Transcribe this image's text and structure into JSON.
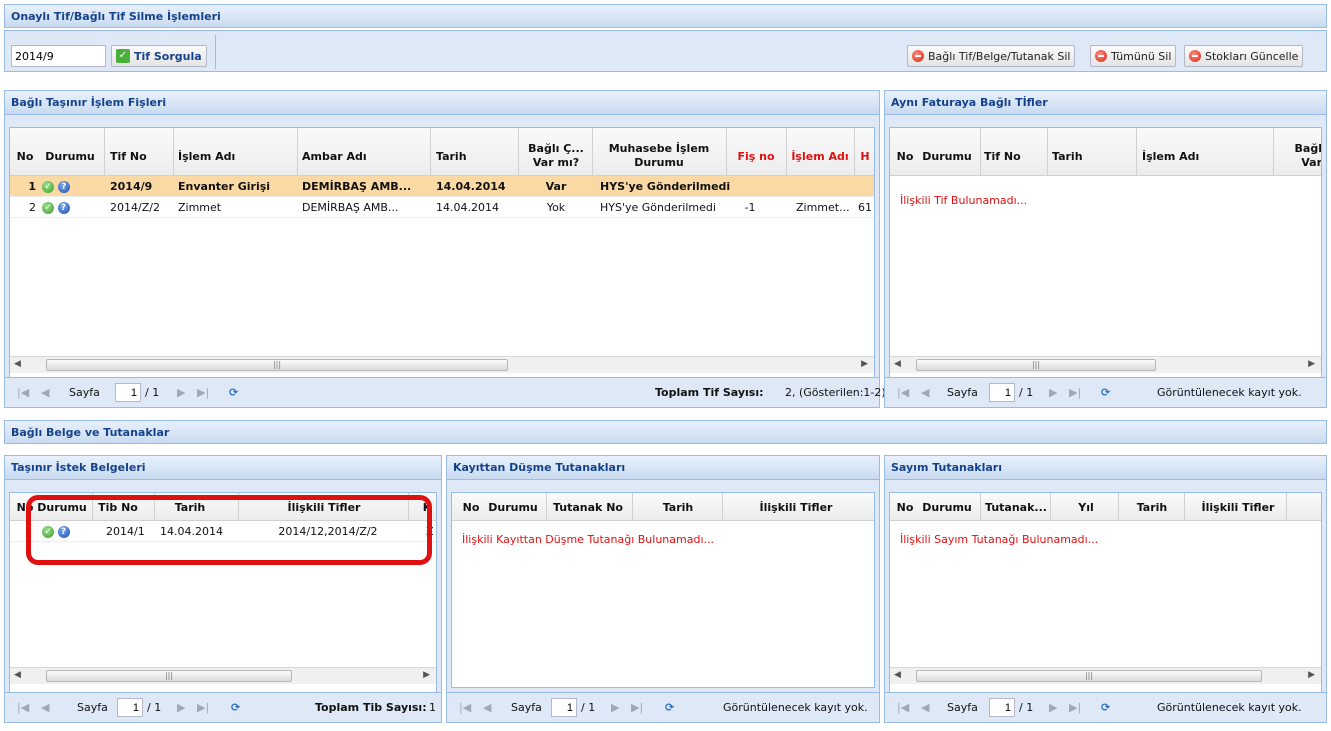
{
  "title": "Onaylı Tif/Bağlı Tif Silme İşlemleri",
  "toolbar": {
    "input_value": "2014/9",
    "query_btn": "Tif Sorgula",
    "delete_linked": "Bağlı Tif/Belge/Tutanak Sil",
    "delete_all": "Tümünü Sil",
    "update_stock": "Stokları Güncelle"
  },
  "bagli": {
    "title": "Bağlı Taşınır İşlem Fişleri",
    "cols": {
      "no": "No",
      "durumu": "Durumu",
      "tifno": "Tif No",
      "islemadi": "İşlem Adı",
      "ambar": "Ambar Adı",
      "tarih": "Tarih",
      "bagli1": "Bağlı Ç...",
      "bagli2": "Var mı?",
      "muh1": "Muhasebe İşlem",
      "muh2": "Durumu",
      "fisno": "Fiş no",
      "islemadi2": "İşlem Adı",
      "h": "H"
    },
    "rows": [
      {
        "no": "1",
        "tifno": "2014/9",
        "islemadi": "Envanter Girişi",
        "ambar": "DEMİRBAŞ AMB...",
        "tarih": "14.04.2014",
        "bagli": "Var",
        "muh": "HYS'ye Gönderilmedi",
        "fisno": "",
        "islemadi2": "",
        "h": ""
      },
      {
        "no": "2",
        "tifno": "2014/Z/2",
        "islemadi": "Zimmet",
        "ambar": "DEMİRBAŞ AMB...",
        "tarih": "14.04.2014",
        "bagli": "Yok",
        "muh": "HYS'ye Gönderilmedi",
        "fisno": "-1",
        "islemadi2": "Zimmet...",
        "h": "61"
      }
    ],
    "pager": {
      "page_label": "Sayfa",
      "page": "1",
      "of": "/ 1",
      "total_label": "Toplam Tif Sayısı:",
      "total": "2, (Gösterilen:1-2)"
    }
  },
  "ayni": {
    "title": "Aynı Faturaya Bağlı Tİfler",
    "cols": {
      "no": "No",
      "durumu": "Durumu",
      "tifno": "Tif No",
      "tarih": "Tarih",
      "islemadi": "İşlem Adı",
      "bagli1": "Bağl",
      "bagli2": "Var"
    },
    "empty": "İlişkili Tif Bulunamadı...",
    "pager": {
      "page_label": "Sayfa",
      "page": "1",
      "of": "/ 1",
      "status": "Görüntülenecek kayıt yok."
    }
  },
  "section2": "Bağlı Belge ve Tutanaklar",
  "istek": {
    "title": "Taşınır İstek Belgeleri",
    "cols": {
      "no": "No",
      "durumu": "Durumu",
      "tibno": "Tib No",
      "tarih": "Tarih",
      "iliskili": "İlişkili Tifler",
      "k": "K"
    },
    "rows": [
      {
        "tibno": "2014/1",
        "tarih": "14.04.2014",
        "iliskili": "2014/12,2014/Z/2",
        "k": "Z"
      }
    ],
    "pager": {
      "page_label": "Sayfa",
      "page": "1",
      "of": "/ 1",
      "total_label": "Toplam Tib Sayısı:",
      "total": "1"
    }
  },
  "kayit": {
    "title": "Kayıttan Düşme Tutanakları",
    "cols": {
      "no": "No",
      "durumu": "Durumu",
      "tutanakno": "Tutanak No",
      "tarih": "Tarih",
      "iliskili": "İlişkili Tifler"
    },
    "empty": "İlişkili Kayıttan Düşme Tutanağı Bulunamadı...",
    "pager": {
      "page_label": "Sayfa",
      "page": "1",
      "of": "/ 1",
      "status": "Görüntülenecek kayıt yok."
    }
  },
  "sayim": {
    "title": "Sayım Tutanakları",
    "cols": {
      "no": "No",
      "durumu": "Durumu",
      "tutanak": "Tutanak...",
      "yil": "Yıl",
      "tarih": "Tarih",
      "iliskili": "İlişkili Tifler"
    },
    "empty": "İlişkili Sayım Tutanağı Bulunamadı...",
    "pager": {
      "page_label": "Sayfa",
      "page": "1",
      "of": "/ 1",
      "status": "Görüntülenecek kayıt yok."
    }
  },
  "colors": {
    "header_text": "#15428b",
    "highlight_row": "#fbd9a4",
    "annotation": "#e01010",
    "border": "#99bbe8"
  }
}
